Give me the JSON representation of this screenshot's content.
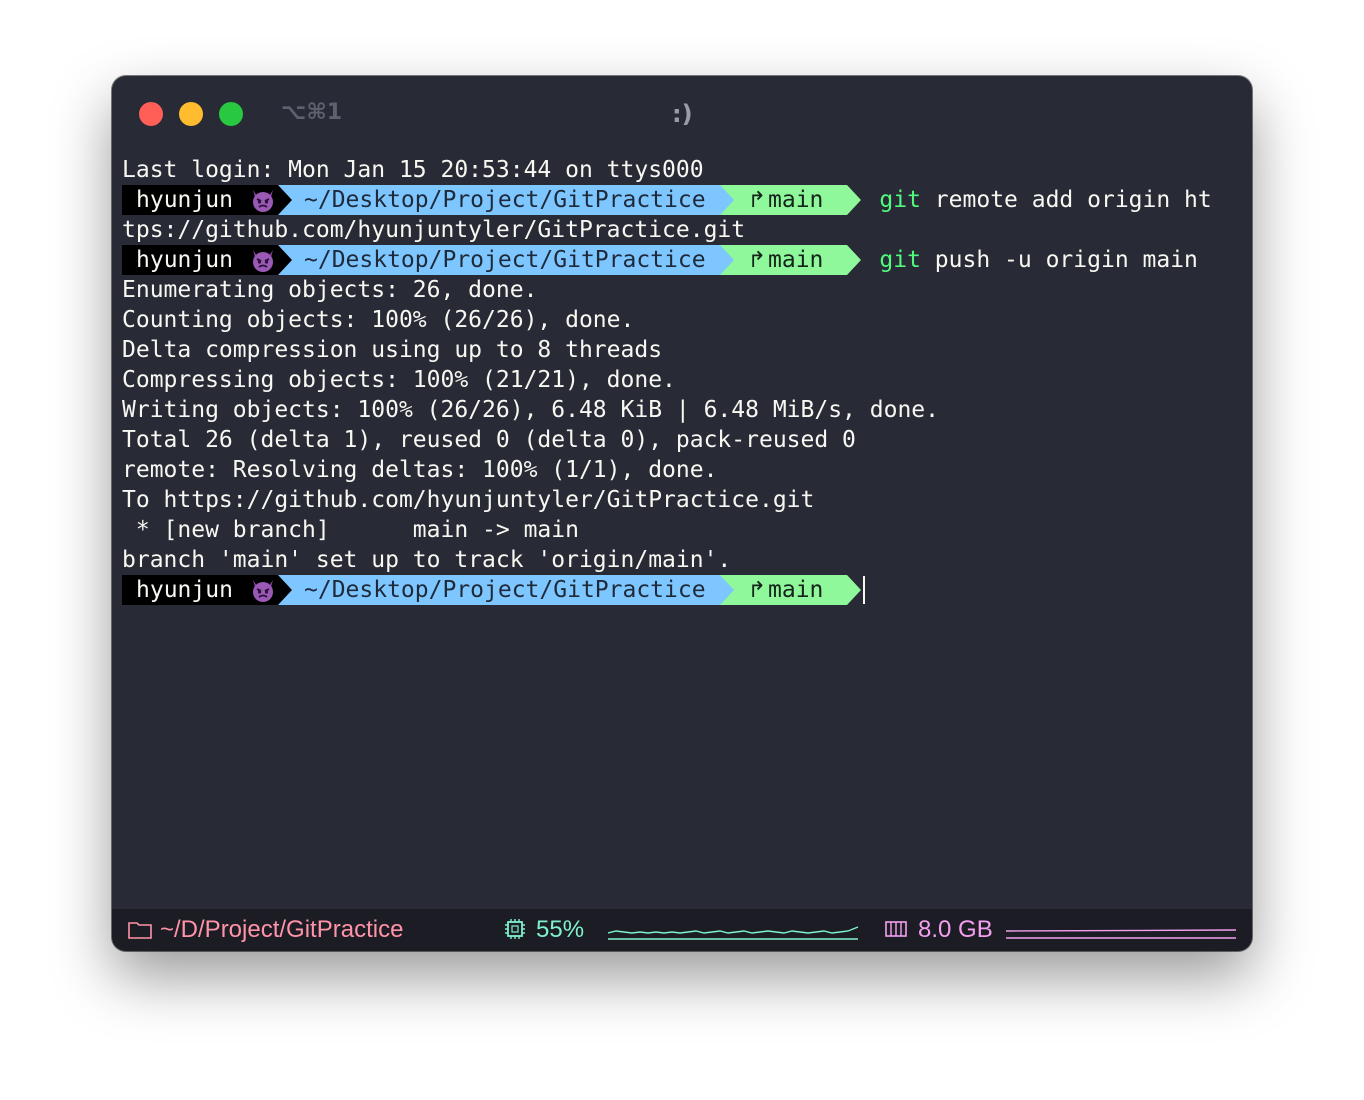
{
  "window": {
    "shortcut": "⌥⌘1",
    "title": ":)"
  },
  "prompt": {
    "user": "hyunjun",
    "user_emoji": "angry-devil-face",
    "path": "~/Desktop/Project/GitPractice",
    "branch_icon": "git-branch-icon",
    "branch": "main"
  },
  "terminal": {
    "last_login": "Last login: Mon Jan 15 20:53:44 on ttys000",
    "cmd1_kw": "git",
    "cmd1_rest": " remote add origin ht",
    "cmd1_wrap": "tps://github.com/hyunjuntyler/GitPractice.git",
    "cmd2_kw": "git",
    "cmd2_rest": " push -u origin main",
    "output": [
      "Enumerating objects: 26, done.",
      "Counting objects: 100% (26/26), done.",
      "Delta compression using up to 8 threads",
      "Compressing objects: 100% (21/21), done.",
      "Writing objects: 100% (26/26), 6.48 KiB | 6.48 MiB/s, done.",
      "Total 26 (delta 1), reused 0 (delta 0), pack-reused 0",
      "remote: Resolving deltas: 100% (1/1), done.",
      "To https://github.com/hyunjuntyler/GitPractice.git",
      " * [new branch]      main -> main",
      "branch 'main' set up to track 'origin/main'."
    ]
  },
  "statusbar": {
    "dir": "~/D/Project/GitPractice",
    "cpu": "55%",
    "mem": "8.0 GB",
    "colors": {
      "dir": "#ff93a8",
      "cpu": "#7ff1d0",
      "mem": "#f59ff0"
    }
  }
}
